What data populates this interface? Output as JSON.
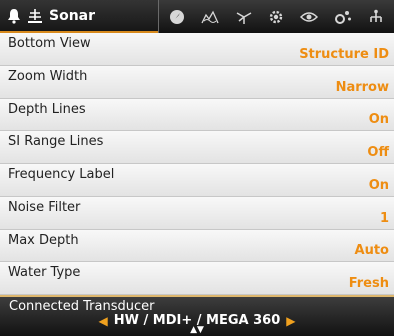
{
  "header": {
    "active_tab_label": "Sonar",
    "left_icons": [
      "alert-bell-icon",
      "sonar-icon"
    ],
    "right_icons": [
      "navigation-icon",
      "chart-icon",
      "gps-icon",
      "settings-icon",
      "view-icon",
      "accessories-icon",
      "network-icon"
    ]
  },
  "menu": {
    "items": [
      {
        "label": "Bottom View",
        "value": "Structure ID"
      },
      {
        "label": "Zoom Width",
        "value": "Narrow"
      },
      {
        "label": "Depth Lines",
        "value": "On"
      },
      {
        "label": "SI Range Lines",
        "value": "Off"
      },
      {
        "label": "Frequency Label",
        "value": "On"
      },
      {
        "label": "Noise Filter",
        "value": "1"
      },
      {
        "label": "Max Depth",
        "value": "Auto"
      },
      {
        "label": "Water Type",
        "value": "Fresh"
      }
    ],
    "selected": {
      "label": "Connected Transducer",
      "value": "HW / MDI+ / MEGA 360"
    }
  },
  "colors": {
    "accent": "#ee8d12",
    "selected_bg": "#1e1e1e",
    "tab_underline": "#d88a1d"
  }
}
